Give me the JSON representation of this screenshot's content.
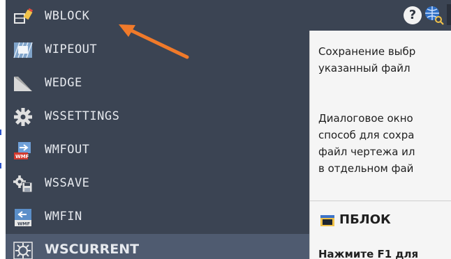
{
  "menu": {
    "items": [
      {
        "label": "WBLOCK",
        "icon": "wblock-icon"
      },
      {
        "label": "WIPEOUT",
        "icon": "wipeout-icon"
      },
      {
        "label": "WEDGE",
        "icon": "wedge-icon"
      },
      {
        "label": "WSSETTINGS",
        "icon": "gear-icon"
      },
      {
        "label": "WMFOUT",
        "icon": "wmfout-icon"
      },
      {
        "label": "WSSAVE",
        "icon": "wssave-icon"
      },
      {
        "label": "WMFIN",
        "icon": "wmfin-icon"
      },
      {
        "label": "WSCURRENT",
        "icon": "wscurrent-icon"
      }
    ]
  },
  "toolbar": {
    "help_label": "?"
  },
  "tooltip": {
    "lines": [
      "Сохранение выбр",
      "указанный файл",
      "",
      "Диалоговое окно",
      "способ для сохра",
      "файл чертежа ил",
      "в отдельном фай"
    ],
    "command_name": "ПБЛОК",
    "f1_hint": "Нажмите F1 для"
  },
  "colors": {
    "panel_bg": "#3b4453",
    "selected_row": "#4f5b70",
    "arrow": "#f07a2a",
    "tooltip_bg": "#f5f5f5",
    "text_light": "#e6e9ee"
  }
}
